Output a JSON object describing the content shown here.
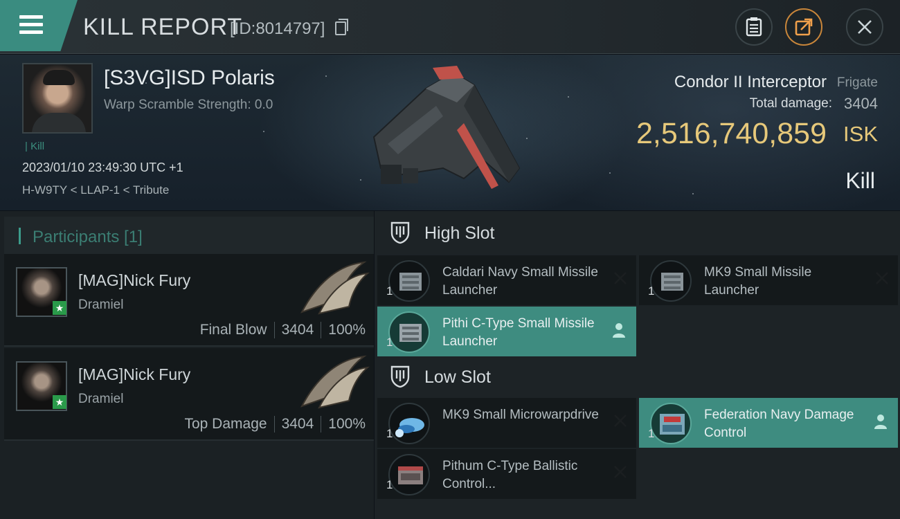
{
  "header": {
    "title": "KILL REPORT",
    "report_id": "[ID:8014797]"
  },
  "victim": {
    "name": "[S3VG]ISD Polaris",
    "warp_scramble": "Warp Scramble Strength: 0.0",
    "tag": "Kill",
    "datetime": "2023/01/10 23:49:30 UTC +1",
    "location": "H-W9TY < LLAP-1 < Tribute",
    "ship_name": "Condor II Interceptor",
    "ship_class": "Frigate",
    "total_damage_label": "Total damage:",
    "total_damage": "3404",
    "isk_value": "2,516,740,859",
    "isk_unit": "ISK",
    "result": "Kill"
  },
  "participants": {
    "label": "Participants [1]",
    "list": [
      {
        "name": "[MAG]Nick Fury",
        "ship": "Dramiel",
        "role": "Final Blow",
        "damage": "3404",
        "percent": "100%"
      },
      {
        "name": "[MAG]Nick Fury",
        "ship": "Dramiel",
        "role": "Top Damage",
        "damage": "3404",
        "percent": "100%"
      }
    ]
  },
  "slots": {
    "high": {
      "label": "High Slot",
      "items": [
        {
          "name": "Caldari Navy Small Missile Launcher",
          "qty": "1",
          "active": false
        },
        {
          "name": "MK9 Small Missile Launcher",
          "qty": "1",
          "active": false
        },
        {
          "name": "Pithi C-Type Small Missile Launcher",
          "qty": "1",
          "active": true
        }
      ]
    },
    "low": {
      "label": "Low Slot",
      "items": [
        {
          "name": "MK9 Small Microwarpdrive",
          "qty": "1",
          "active": false
        },
        {
          "name": "Federation Navy Damage Control",
          "qty": "1",
          "active": true
        },
        {
          "name": "Pithum C-Type Ballistic Control...",
          "qty": "1",
          "active": false
        }
      ]
    }
  },
  "colors": {
    "accent": "#3e8c80",
    "isk": "#e6c87a"
  },
  "icons": [
    "menu-icon",
    "copy-icon",
    "clipboard-icon",
    "share-icon",
    "close-icon",
    "shield-icon",
    "remove-icon",
    "person-icon"
  ]
}
